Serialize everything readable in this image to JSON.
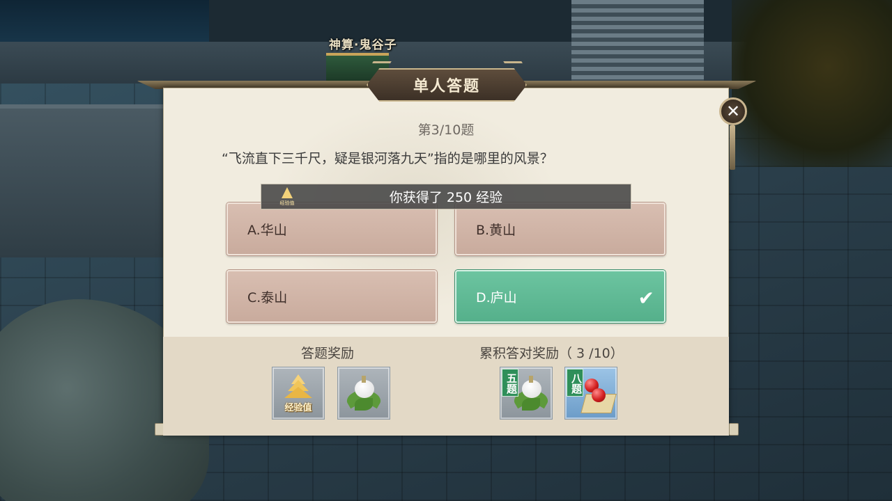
{
  "npc_name": "神算·鬼谷子",
  "dialog": {
    "title": "单人答题",
    "question_number": "第3/10题",
    "question_text": "“飞流直下三千尺，疑是银河落九天”指的是哪里的风景？",
    "options": [
      {
        "label": "A.华山",
        "state": "normal"
      },
      {
        "label": "B.黄山",
        "state": "normal"
      },
      {
        "label": "C.泰山",
        "state": "normal"
      },
      {
        "label": "D.庐山",
        "state": "correct"
      }
    ],
    "close_icon": "close-icon"
  },
  "toast": {
    "message": "你获得了 250 经验",
    "icon_label": "经验值"
  },
  "rewards": {
    "answer_reward_title": "答题奖励",
    "cumulative_reward_title": "累积答对奖励（ 3 /10）",
    "answer_items": [
      {
        "icon": "exp-icon",
        "label": "经验值"
      },
      {
        "icon": "zongzi-icon"
      }
    ],
    "cumulative_items": [
      {
        "tag": "五题",
        "icon": "zongzi-icon"
      },
      {
        "tag": "八题",
        "icon": "red-berries-icon"
      }
    ]
  },
  "colors": {
    "panel_bg": "#f1ecdf",
    "option_bg": "#d2b5a7",
    "option_correct": "#5fb995",
    "title_plaque": "#4d3f31"
  }
}
